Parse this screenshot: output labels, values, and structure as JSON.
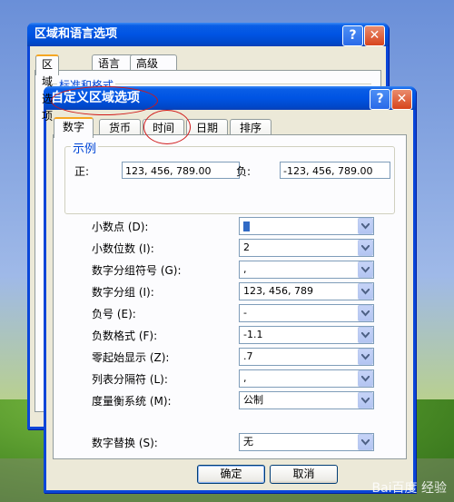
{
  "back_window": {
    "title": "区域和语言选项",
    "help_btn": "?",
    "close_btn": "✕",
    "tabs": [
      "区域选项",
      "语言",
      "高级"
    ],
    "group_label": "标准和格式"
  },
  "front_window": {
    "title": "自定义区域选项",
    "help_btn": "?",
    "close_btn": "✕",
    "tabs": [
      "数字",
      "货币",
      "时间",
      "日期",
      "排序"
    ],
    "sample": {
      "label": "示例",
      "positive_label": "正:",
      "positive_value": "123, 456, 789.00",
      "negative_label": "负:",
      "negative_value": "-123, 456, 789.00"
    },
    "settings": [
      {
        "label": "小数点 (D):",
        "value": ""
      },
      {
        "label": "小数位数 (I):",
        "value": "2"
      },
      {
        "label": "数字分组符号 (G):",
        "value": ","
      },
      {
        "label": "数字分组 (I):",
        "value": "123, 456, 789"
      },
      {
        "label": "负号 (E):",
        "value": "-"
      },
      {
        "label": "负数格式 (F):",
        "value": "-1.1"
      },
      {
        "label": "零起始显示 (Z):",
        "value": ".7"
      },
      {
        "label": "列表分隔符 (L):",
        "value": ","
      },
      {
        "label": "度量衡系统 (M):",
        "value": "公制"
      },
      {
        "label": "数字替换 (S):",
        "value": "无"
      }
    ],
    "ok_label": "确定",
    "cancel_label": "取消"
  },
  "watermark": "Bai百度 经验",
  "colors": {
    "title_blue": "#0054e3",
    "annotation_red": "#d01818",
    "group_label_blue": "#0046d5"
  }
}
